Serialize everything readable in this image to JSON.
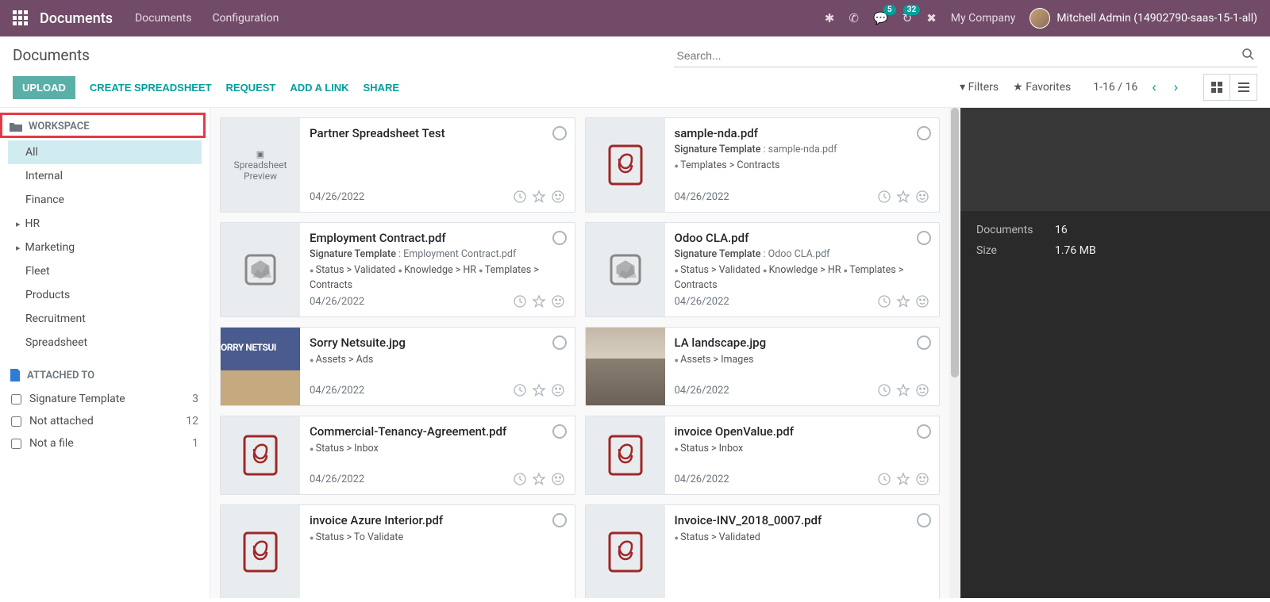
{
  "topnav": {
    "brand": "Documents",
    "links": [
      "Documents",
      "Configuration"
    ],
    "msg_badge": "5",
    "activity_badge": "32",
    "company": "My Company",
    "user": "Mitchell Admin (14902790-saas-15-1-all)"
  },
  "cp": {
    "title": "Documents",
    "search_placeholder": "Search...",
    "buttons": {
      "upload": "UPLOAD",
      "create_spreadsheet": "CREATE SPREADSHEET",
      "request": "REQUEST",
      "add_link": "ADD A LINK",
      "share": "SHARE"
    },
    "filters_label": "Filters",
    "favorites_label": "Favorites",
    "paging": "1-16 / 16"
  },
  "sidebar": {
    "workspace_header": "WORKSPACE",
    "workspaces": [
      {
        "label": "All",
        "selected": true,
        "expandable": false
      },
      {
        "label": "Internal",
        "selected": false,
        "expandable": false
      },
      {
        "label": "Finance",
        "selected": false,
        "expandable": false
      },
      {
        "label": "HR",
        "selected": false,
        "expandable": true
      },
      {
        "label": "Marketing",
        "selected": false,
        "expandable": true
      },
      {
        "label": "Fleet",
        "selected": false,
        "expandable": false
      },
      {
        "label": "Products",
        "selected": false,
        "expandable": false
      },
      {
        "label": "Recruitment",
        "selected": false,
        "expandable": false
      },
      {
        "label": "Spreadsheet",
        "selected": false,
        "expandable": false
      }
    ],
    "attached_header": "ATTACHED TO",
    "attached": [
      {
        "label": "Signature Template",
        "count": "3"
      },
      {
        "label": "Not attached",
        "count": "12"
      },
      {
        "label": "Not a file",
        "count": "1"
      }
    ]
  },
  "cards": [
    {
      "title": "Partner Spreadsheet Test",
      "sub_label": "",
      "sub_value": "",
      "tags": [],
      "date": "04/26/2022",
      "thumb": "spreadsheet"
    },
    {
      "title": "sample-nda.pdf",
      "sub_label": "Signature Template",
      "sub_value": "sample-nda.pdf",
      "tags": [
        "Templates > Contracts"
      ],
      "date": "04/26/2022",
      "thumb": "pdf"
    },
    {
      "title": "Employment Contract.pdf",
      "sub_label": "Signature Template",
      "sub_value": "Employment Contract.pdf",
      "tags": [
        "Status > Validated",
        "Knowledge > HR",
        "Templates > Contracts"
      ],
      "date": "04/26/2022",
      "thumb": "file"
    },
    {
      "title": "Odoo CLA.pdf",
      "sub_label": "Signature Template",
      "sub_value": "Odoo CLA.pdf",
      "tags": [
        "Status > Validated",
        "Knowledge > HR",
        "Templates > Contracts"
      ],
      "date": "04/26/2022",
      "thumb": "file"
    },
    {
      "title": "Sorry Netsuite.jpg",
      "sub_label": "",
      "sub_value": "",
      "tags": [
        "Assets > Ads"
      ],
      "date": "04/26/2022",
      "thumb": "img1"
    },
    {
      "title": "LA landscape.jpg",
      "sub_label": "",
      "sub_value": "",
      "tags": [
        "Assets > Images"
      ],
      "date": "04/26/2022",
      "thumb": "img2"
    },
    {
      "title": "Commercial-Tenancy-Agreement.pdf",
      "sub_label": "",
      "sub_value": "",
      "tags": [
        "Status > Inbox"
      ],
      "date": "04/26/2022",
      "thumb": "pdf"
    },
    {
      "title": "invoice OpenValue.pdf",
      "sub_label": "",
      "sub_value": "",
      "tags": [
        "Status > Inbox"
      ],
      "date": "04/26/2022",
      "thumb": "pdf"
    },
    {
      "title": "invoice Azure Interior.pdf",
      "sub_label": "",
      "sub_value": "",
      "tags": [
        "Status > To Validate"
      ],
      "date": "",
      "thumb": "pdf"
    },
    {
      "title": "Invoice-INV_2018_0007.pdf",
      "sub_label": "",
      "sub_value": "",
      "tags": [
        "Status > Validated"
      ],
      "date": "",
      "thumb": "pdf"
    }
  ],
  "rpanel": {
    "rows": [
      {
        "k": "Documents",
        "v": "16"
      },
      {
        "k": "Size",
        "v": "1.76 MB"
      }
    ]
  },
  "thumb_spreadsheet_text": "Spreadsheet Preview"
}
